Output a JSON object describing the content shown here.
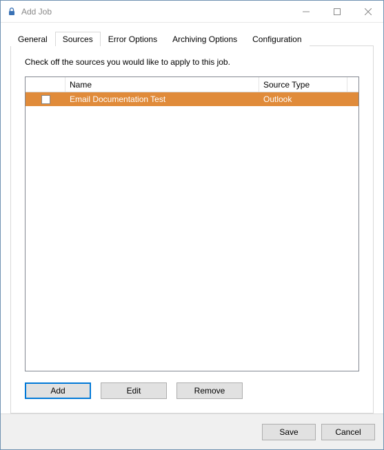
{
  "window": {
    "title": "Add Job"
  },
  "tabs": {
    "general": "General",
    "sources": "Sources",
    "error_options": "Error Options",
    "archiving_options": "Archiving Options",
    "configuration": "Configuration",
    "active": "sources"
  },
  "sources_panel": {
    "instructions": "Check off the sources you would like to apply to this job.",
    "columns": {
      "name": "Name",
      "type": "Source Type"
    },
    "rows": [
      {
        "checked": false,
        "name": "Email Documentation Test",
        "type": "Outlook"
      }
    ],
    "buttons": {
      "add": "Add",
      "edit": "Edit",
      "remove": "Remove"
    }
  },
  "footer": {
    "save": "Save",
    "cancel": "Cancel"
  },
  "colors": {
    "row_selected": "#e08b3a",
    "accent": "#0078d7"
  }
}
